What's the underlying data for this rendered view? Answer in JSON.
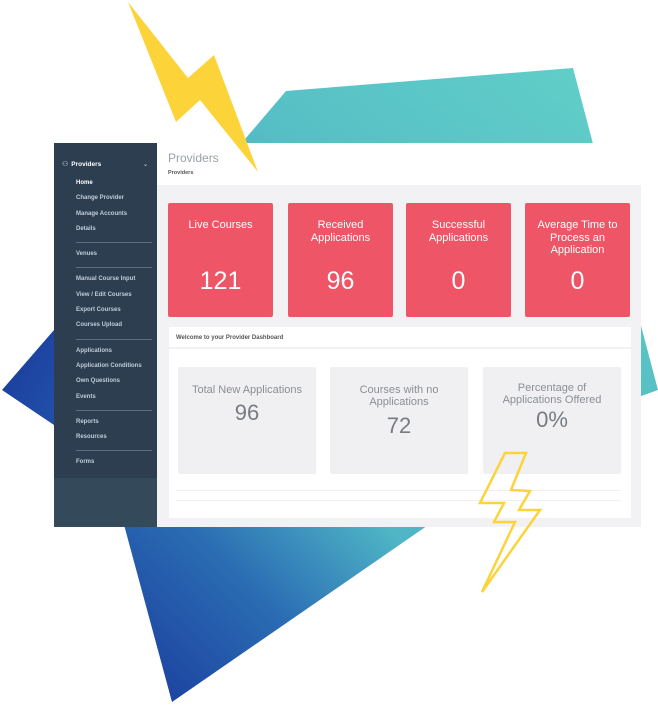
{
  "sidebar": {
    "section_label": "Providers",
    "section_icon": "users-icon",
    "groups": [
      [
        {
          "label": "Home",
          "active": true
        },
        {
          "label": "Change Provider",
          "active": false
        },
        {
          "label": "Manage Accounts",
          "active": false
        },
        {
          "label": "Details",
          "active": false
        }
      ],
      [
        {
          "label": "Venues",
          "active": false
        }
      ],
      [
        {
          "label": "Manual Course Input",
          "active": false
        },
        {
          "label": "View / Edit Courses",
          "active": false
        },
        {
          "label": "Export Courses",
          "active": false
        },
        {
          "label": "Courses Upload",
          "active": false
        }
      ],
      [
        {
          "label": "Applications",
          "active": false
        },
        {
          "label": "Application Conditions",
          "active": false
        },
        {
          "label": "Own Questions",
          "active": false
        },
        {
          "label": "Events",
          "active": false
        }
      ],
      [
        {
          "label": "Reports",
          "active": false
        },
        {
          "label": "Resources",
          "active": false
        }
      ],
      [
        {
          "label": "Forms",
          "active": false
        }
      ]
    ]
  },
  "header": {
    "title": "Providers",
    "breadcrumb": "Providers"
  },
  "stats": [
    {
      "label": "Live Courses",
      "value": "121"
    },
    {
      "label": "Received Applications",
      "value": "96"
    },
    {
      "label": "Successful Applications",
      "value": "0"
    },
    {
      "label": "Average Time to Process an Application",
      "value": "0"
    }
  ],
  "welcome_panel": {
    "title": "Welcome to your Provider Dashboard",
    "cards": [
      {
        "label": "Total New Applications",
        "value": "96"
      },
      {
        "label": "Courses with no Applications",
        "value": "72"
      },
      {
        "label": "Percentage of Applications Offered",
        "value": "0%"
      }
    ]
  },
  "colors": {
    "sidebar_bg": "#2c3e50",
    "stat_card": "#ee5566",
    "content_bg": "#f2f2f4",
    "bolt_yellow": "#fdd33a",
    "teal": "#5fcfc7",
    "blue": "#1a3a9c"
  }
}
